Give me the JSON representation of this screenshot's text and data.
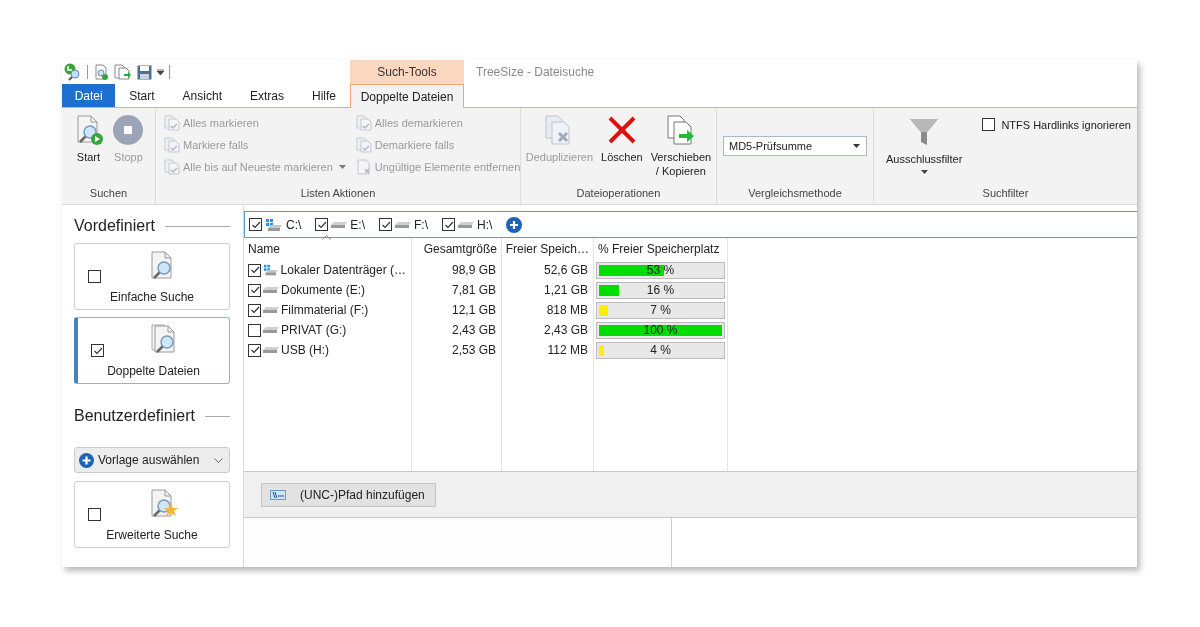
{
  "window": {
    "title": "TreeSize - Dateisuche"
  },
  "contextual_tab_group": {
    "label": "Such-Tools"
  },
  "tabs": [
    {
      "label": "Datei",
      "kind": "file",
      "selected": false
    },
    {
      "label": "Start",
      "kind": "tab",
      "selected": false
    },
    {
      "label": "Ansicht",
      "kind": "tab",
      "selected": false
    },
    {
      "label": "Extras",
      "kind": "tab",
      "selected": false
    },
    {
      "label": "Hilfe",
      "kind": "tab",
      "selected": false
    },
    {
      "label": "Doppelte Dateien",
      "kind": "contextual",
      "selected": true
    }
  ],
  "ribbon": {
    "groups": [
      {
        "label": "Suchen",
        "kind": "large",
        "items": [
          {
            "label": "Start",
            "kind": "start",
            "disabled": false
          },
          {
            "label": "Stopp",
            "kind": "stop",
            "disabled": true
          }
        ]
      },
      {
        "label": "Listen Aktionen",
        "kind": "small",
        "items": [
          {
            "label": "Alles markieren",
            "kind": "mark",
            "disabled": true,
            "dropdown": false
          },
          {
            "label": "Markiere falls",
            "kind": "mark",
            "disabled": true,
            "dropdown": false
          },
          {
            "label": "Alle bis auf Neueste markieren",
            "kind": "mark",
            "disabled": true,
            "dropdown": true
          },
          {
            "label": "Alles demarkieren",
            "kind": "mark",
            "disabled": true,
            "dropdown": false
          },
          {
            "label": "Demarkiere falls",
            "kind": "mark",
            "disabled": true,
            "dropdown": false
          },
          {
            "label": "Ungültige Elemente entfernen",
            "kind": "remove",
            "disabled": true,
            "dropdown": false
          }
        ]
      },
      {
        "label": "Dateioperationen",
        "kind": "large",
        "items": [
          {
            "label": "Deduplizieren",
            "kind": "dedupe",
            "disabled": true
          },
          {
            "label": "Löschen",
            "kind": "delete",
            "disabled": false
          },
          {
            "label": "Verschieben / Kopieren",
            "kind": "move",
            "disabled": false
          }
        ]
      },
      {
        "label": "Vergleichsmethode",
        "kind": "dropdown",
        "value": "MD5-Prüfsumme"
      },
      {
        "label": "Suchfilter",
        "kind": "filter",
        "button": {
          "label": "Ausschlussfilter"
        },
        "checkbox": {
          "label": "NTFS Hardlinks ignorieren",
          "checked": false
        }
      }
    ]
  },
  "sidebar": {
    "sections": [
      {
        "title": "Vordefiniert",
        "cards": [
          {
            "label": "Einfache Suche",
            "kind": "simple",
            "checked": false,
            "selected": false
          },
          {
            "label": "Doppelte Dateien",
            "kind": "duplicates",
            "checked": true,
            "selected": true
          }
        ]
      },
      {
        "title": "Benutzerdefiniert",
        "template_button": "Vorlage auswählen",
        "cards": [
          {
            "label": "Erweiterte Suche",
            "kind": "advanced",
            "checked": false,
            "selected": false
          }
        ]
      }
    ]
  },
  "drives": [
    {
      "label": "C:\\",
      "kind": "system",
      "checked": true
    },
    {
      "label": "E:\\",
      "kind": "drive",
      "checked": true
    },
    {
      "label": "F:\\",
      "kind": "drive",
      "checked": true
    },
    {
      "label": "H:\\",
      "kind": "drive",
      "checked": true
    }
  ],
  "drive_table": {
    "columns": [
      "Name",
      "Gesamtgröße",
      "Freier Speich…",
      "% Freier Speicherplatz"
    ],
    "rows": [
      {
        "name": "Lokaler Datenträger (…",
        "kind": "system",
        "checked": true,
        "total": "98,9 GB",
        "free": "52,6 GB",
        "level": 0.53,
        "percent": "53 %",
        "color": "#00dd00"
      },
      {
        "name": "Dokumente (E:)",
        "kind": "drive",
        "checked": true,
        "total": "7,81 GB",
        "free": "1,21 GB",
        "level": 0.16,
        "percent": "16 %",
        "color": "#00dd00"
      },
      {
        "name": "Filmmaterial (F:)",
        "kind": "drive",
        "checked": true,
        "total": "12,1 GB",
        "free": "818 MB",
        "level": 0.07,
        "percent": "7 %",
        "color": "#ffee00"
      },
      {
        "name": "PRIVAT (G:)",
        "kind": "drive",
        "checked": false,
        "total": "2,43 GB",
        "free": "2,43 GB",
        "level": 1,
        "percent": "100 %",
        "color": "#00dd00"
      },
      {
        "name": "USB (H:)",
        "kind": "drive",
        "checked": true,
        "total": "2,53 GB",
        "free": "112 MB",
        "level": 0.04,
        "percent": "4 %",
        "color": "#ffee00"
      }
    ]
  },
  "add_path_button": {
    "label": "(UNC-)Pfad hinzufügen"
  }
}
